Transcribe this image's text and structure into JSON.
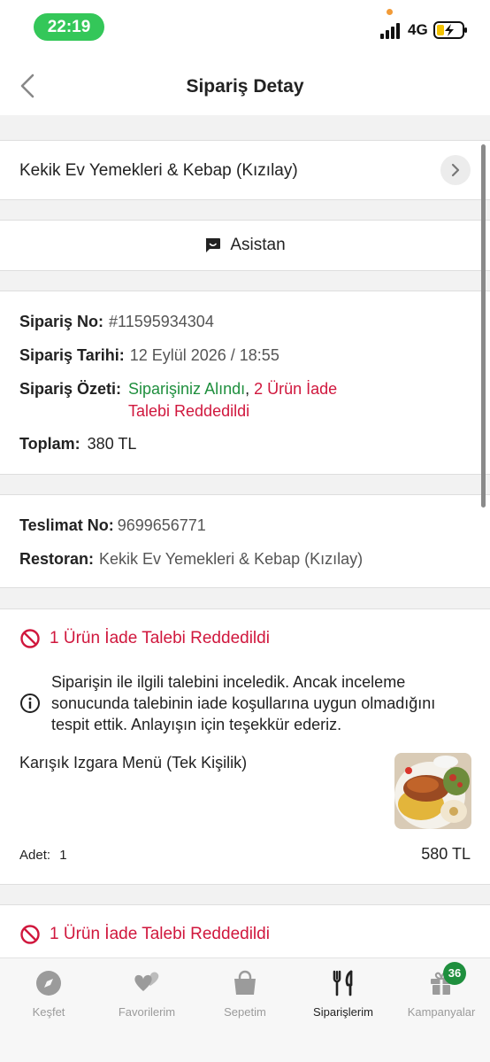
{
  "status_bar": {
    "time": "22:19",
    "network": "4G",
    "time_pill_color": "#34c759"
  },
  "header": {
    "title": "Sipariş Detay",
    "back_icon": "chevron-left-icon"
  },
  "restaurant_row": {
    "name": "Kekik Ev Yemekleri & Kebap (Kızılay)",
    "chevron_icon": "chevron-right-icon"
  },
  "assistant": {
    "label": "Asistan",
    "icon": "chat-smile-icon"
  },
  "order": {
    "no_label": "Sipariş No:",
    "no_value": "#11595934304",
    "date_label": "Sipariş Tarihi:",
    "date_value": "12 Eylül 2026 / 18:55",
    "summary_label": "Sipariş Özeti:",
    "summary_received": "Siparişiniz Alındı",
    "summary_sep": ", ",
    "summary_refund_line1": "2 Ürün İade",
    "summary_refund_line2": "Talebi Reddedildi",
    "total_label": "Toplam:",
    "total_value": "380 TL"
  },
  "delivery": {
    "no_label": "Teslimat No:",
    "no_value": "9699656771",
    "restaurant_label": "Restoran:",
    "restaurant_value": "Kekik Ev Yemekleri & Kebap (Kızılay)"
  },
  "refund_cards": [
    {
      "title": "1 Ürün İade Talebi Reddedildi",
      "info_lines": [
        "Siparişin ile ilgili talebini inceledik. Ancak inceleme",
        "sonucunda talebinin iade koşullarına uygun olmadığını",
        "tespit ettik. Anlayışın için teşekkür ederiz."
      ],
      "item_name": "Karışık Izgara Menü (Tek Kişilik)",
      "qty_label": "Adet:",
      "qty_value": "1",
      "price": "580 TL"
    },
    {
      "title": "1 Ürün İade Talebi Reddedildi"
    }
  ],
  "tab_bar": {
    "tabs": [
      {
        "label": "Keşfet",
        "icon": "compass-icon"
      },
      {
        "label": "Favorilerim",
        "icon": "hearts-icon"
      },
      {
        "label": "Sepetim",
        "icon": "basket-icon"
      },
      {
        "label": "Siparişlerim",
        "icon": "fork-knife-icon",
        "active": true
      },
      {
        "label": "Kampanyalar",
        "icon": "gift-icon"
      }
    ],
    "campaign_badge": "36"
  },
  "colors": {
    "success": "#1f8f3e",
    "danger": "#d0173d",
    "active_tab": "#222222",
    "inactive_tab": "#9b9b9b"
  }
}
